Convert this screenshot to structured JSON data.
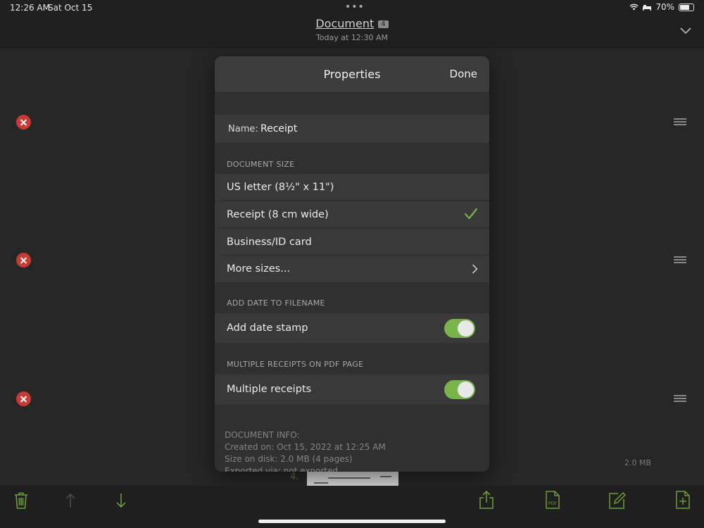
{
  "status_bar": {
    "time": "12:26 AM",
    "date": "Sat Oct 15",
    "battery": "70%"
  },
  "header": {
    "title": "Document",
    "badge": "4",
    "subtitle": "Today at 12:30 AM"
  },
  "list": {
    "size_label": "2.0 MB",
    "page_number": "4."
  },
  "modal": {
    "title": "Properties",
    "done_label": "Done",
    "name_label": "Name:",
    "name_value": "Receipt",
    "sections": {
      "document_size": "DOCUMENT SIZE",
      "add_date": "ADD DATE TO FILENAME",
      "multiple_receipts": "MULTIPLE RECEIPTS ON PDF PAGE"
    },
    "size_options": [
      {
        "label": "US letter (8½\" x 11\")"
      },
      {
        "label": "Receipt (8 cm wide)"
      },
      {
        "label": "Business/ID card"
      },
      {
        "label": "More sizes..."
      }
    ],
    "selected_size": "Receipt (8 cm wide)",
    "add_date_stamp": {
      "label": "Add date stamp",
      "on": true
    },
    "multiple_receipts": {
      "label": "Multiple receipts",
      "on": true
    },
    "info": {
      "header": "DOCUMENT INFO:",
      "created": "Created on: Oct 15, 2022 at 12:25 AM",
      "size": "Size on disk: 2.0 MB (4 pages)",
      "exported": "Exported via: not exported"
    }
  },
  "toolbar": {
    "icons": [
      "trash-icon",
      "arrow-up-icon",
      "arrow-down-icon",
      "share-icon",
      "pdf-icon",
      "edit-icon",
      "add-page-icon"
    ]
  },
  "colors": {
    "accent": "#78b44a",
    "delete": "#c73a35",
    "background": "#262626",
    "modal": "#303030"
  }
}
